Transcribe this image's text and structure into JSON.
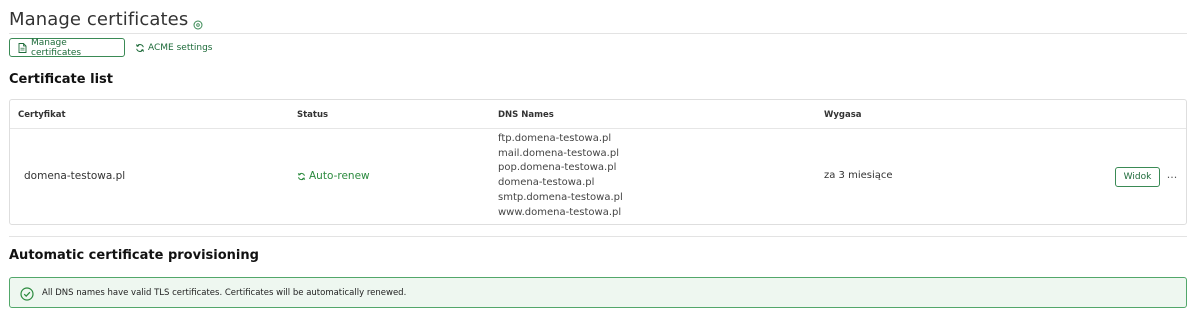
{
  "header": {
    "title": "Manage certificates",
    "help_icon": "help-circle-icon"
  },
  "tabs": [
    {
      "label": "Manage certificates",
      "icon": "document-icon",
      "active": true
    },
    {
      "label": "ACME settings",
      "icon": "refresh-icon",
      "active": false
    }
  ],
  "certificate_list": {
    "title": "Certificate list",
    "columns": [
      "Certyfikat",
      "Status",
      "DNS Names",
      "Wygasa"
    ],
    "rows": [
      {
        "certificate": "domena-testowa.pl",
        "status": "Auto-renew",
        "dns_names": [
          "ftp.domena-testowa.pl",
          "mail.domena-testowa.pl",
          "pop.domena-testowa.pl",
          "domena-testowa.pl",
          "smtp.domena-testowa.pl",
          "www.domena-testowa.pl"
        ],
        "expires": "za 3 miesiące",
        "view_label": "Widok",
        "more_label": "···"
      }
    ]
  },
  "provisioning": {
    "title": "Automatic certificate provisioning",
    "message": "All DNS names have valid TLS certificates. Certificates will be automatically renewed.",
    "icon": "check-circle-icon"
  },
  "colors": {
    "accent": "#1e6b3a",
    "success": "#2b8a3e",
    "alert_border": "#52a76a",
    "alert_bg": "#eef7f0"
  }
}
